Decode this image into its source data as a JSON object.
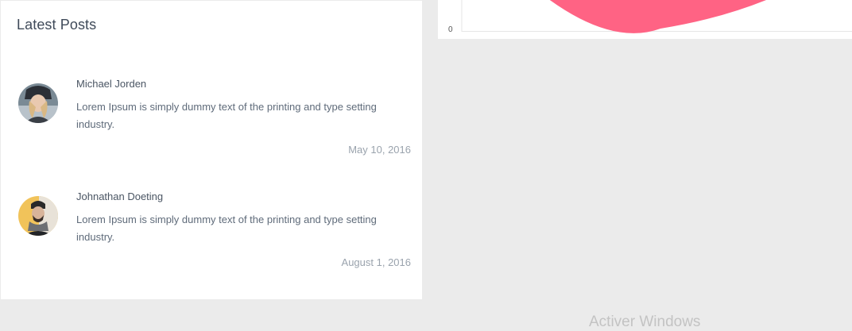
{
  "latest_posts": {
    "title": "Latest Posts",
    "posts": [
      {
        "author": "Michael Jorden",
        "text": "Lorem Ipsum is simply dummy text of the printing and type setting industry.",
        "date": "May 10, 2016",
        "avatar": "avatar-woman-beanie"
      },
      {
        "author": "Johnathan Doeting",
        "text": "Lorem Ipsum is simply dummy text of the printing and type setting industry.",
        "date": "August 1, 2016",
        "avatar": "avatar-man-scarf"
      }
    ]
  },
  "chart": {
    "y_tick_label": "0",
    "color": "#ff6384"
  },
  "watermark": {
    "text": "Activer Windows"
  }
}
